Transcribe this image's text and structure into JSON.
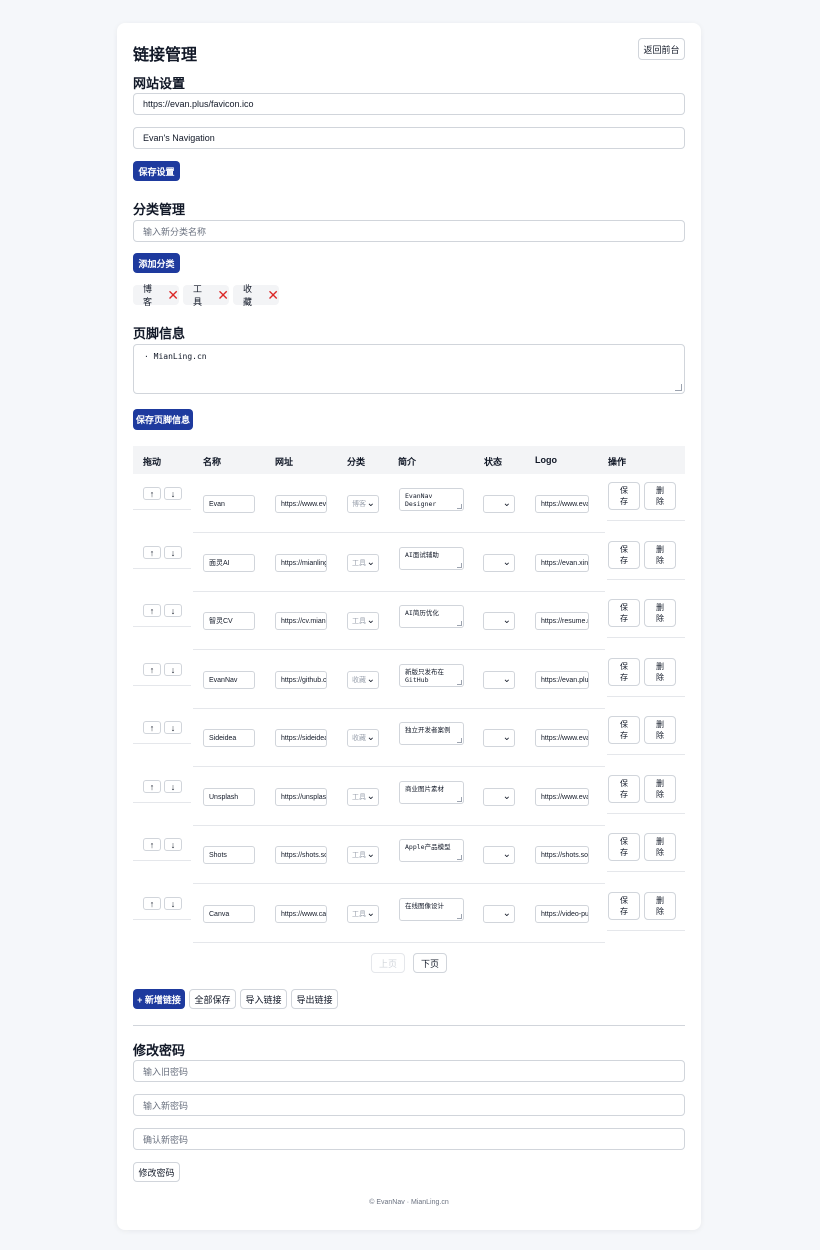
{
  "header": {
    "title": "链接管理",
    "back_button": "返回前台"
  },
  "site_settings": {
    "heading": "网站设置",
    "favicon_value": "https://evan.plus/favicon.ico",
    "site_name_value": "Evan's Navigation",
    "save_label": "保存设置"
  },
  "categories": {
    "heading": "分类管理",
    "input_placeholder": "输入新分类名称",
    "add_label": "添加分类",
    "tags": [
      {
        "label": "博客"
      },
      {
        "label": "工具"
      },
      {
        "label": "收藏"
      }
    ],
    "remove_glyph": "✕"
  },
  "footer_info": {
    "heading": "页脚信息",
    "content": "· MianLing.cn",
    "save_label": "保存页脚信息"
  },
  "table": {
    "headers": [
      "拖动",
      "名称",
      "网址",
      "分类",
      "简介",
      "状态",
      "Logo",
      "操作"
    ],
    "up_glyph": "↑",
    "down_glyph": "↓",
    "save_label": "保存",
    "delete_label": "删除",
    "rows": [
      {
        "name": "Evan",
        "url": "https://www.evan.plus",
        "category": "博客",
        "desc": "EvanNav Designer",
        "status": "",
        "logo": "https://www.evan.plus/logo.png"
      },
      {
        "name": "面灵AI",
        "url": "https://mianling.cn",
        "category": "工具",
        "desc": "AI面试辅助",
        "status": "",
        "logo": "https://evan.xin/logo.png"
      },
      {
        "name": "智灵CV",
        "url": "https://cv.mianling.cn",
        "category": "工具",
        "desc": "AI简历优化",
        "status": "",
        "logo": "https://resume.mianling.cn"
      },
      {
        "name": "EvanNav",
        "url": "https://github.com/evan",
        "category": "收藏",
        "desc": "新版只发布在GitHub",
        "status": "",
        "logo": "https://evan.plus/logo.png"
      },
      {
        "name": "Sideidea",
        "url": "https://sideidea.com",
        "category": "收藏",
        "desc": "独立开发者案例",
        "status": "",
        "logo": "https://www.evan.plus"
      },
      {
        "name": "Unsplash",
        "url": "https://unsplash.com",
        "category": "工具",
        "desc": "商业图片素材",
        "status": "",
        "logo": "https://www.evan.plus"
      },
      {
        "name": "Shots",
        "url": "https://shots.so",
        "category": "工具",
        "desc": "Apple产品模型",
        "status": "",
        "logo": "https://shots.so/"
      },
      {
        "name": "Canva",
        "url": "https://www.canva.com",
        "category": "工具",
        "desc": "在线图像设计",
        "status": "",
        "logo": "https://video-public.canva.com"
      }
    ]
  },
  "pagination": {
    "prev_label": "上页",
    "next_label": "下页"
  },
  "bulk_actions": {
    "add_label": "+ 新增链接",
    "save_all_label": "全部保存",
    "import_label": "导入链接",
    "export_label": "导出链接"
  },
  "password": {
    "heading": "修改密码",
    "old_placeholder": "输入旧密码",
    "new_placeholder": "输入新密码",
    "confirm_placeholder": "确认新密码",
    "submit_label": "修改密码"
  },
  "page_footer": "© EvanNav · MianLing.cn"
}
